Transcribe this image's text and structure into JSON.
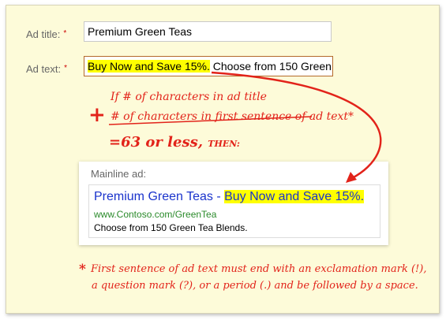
{
  "form": {
    "title_label": "Ad title:",
    "text_label": "Ad text:",
    "required_mark": "*",
    "title_value": "Premium Green Teas",
    "text_value_highlight": "Buy Now and Save 15%.",
    "text_value_rest": " Choose from 150 Green"
  },
  "annotation": {
    "line1": "If # of characters in ad title",
    "plus": "+",
    "line2": "# of characters in first sentence of ad text*",
    "line3": "=63 or less,",
    "line3_then": "THEN:",
    "footnote_star": "*",
    "footnote_line1": "First sentence of ad text must end with an exclamation mark (!),",
    "footnote_line2": "a question mark (?), or a period (.) and be followed by a space."
  },
  "preview": {
    "label": "Mainline ad:",
    "headline_title": "Premium Green Teas",
    "headline_sep": " - ",
    "headline_highlight": "Buy Now and Save 15%.",
    "url": "www.Contoso.com/GreenTea",
    "description": "Choose from 150 Green Tea Blends."
  },
  "colors": {
    "background": "#fdfbd9",
    "annotation_red": "#e2231a",
    "highlight": "#ffff00",
    "headline_blue": "#1a33cc",
    "url_green": "#2a8a2a"
  }
}
